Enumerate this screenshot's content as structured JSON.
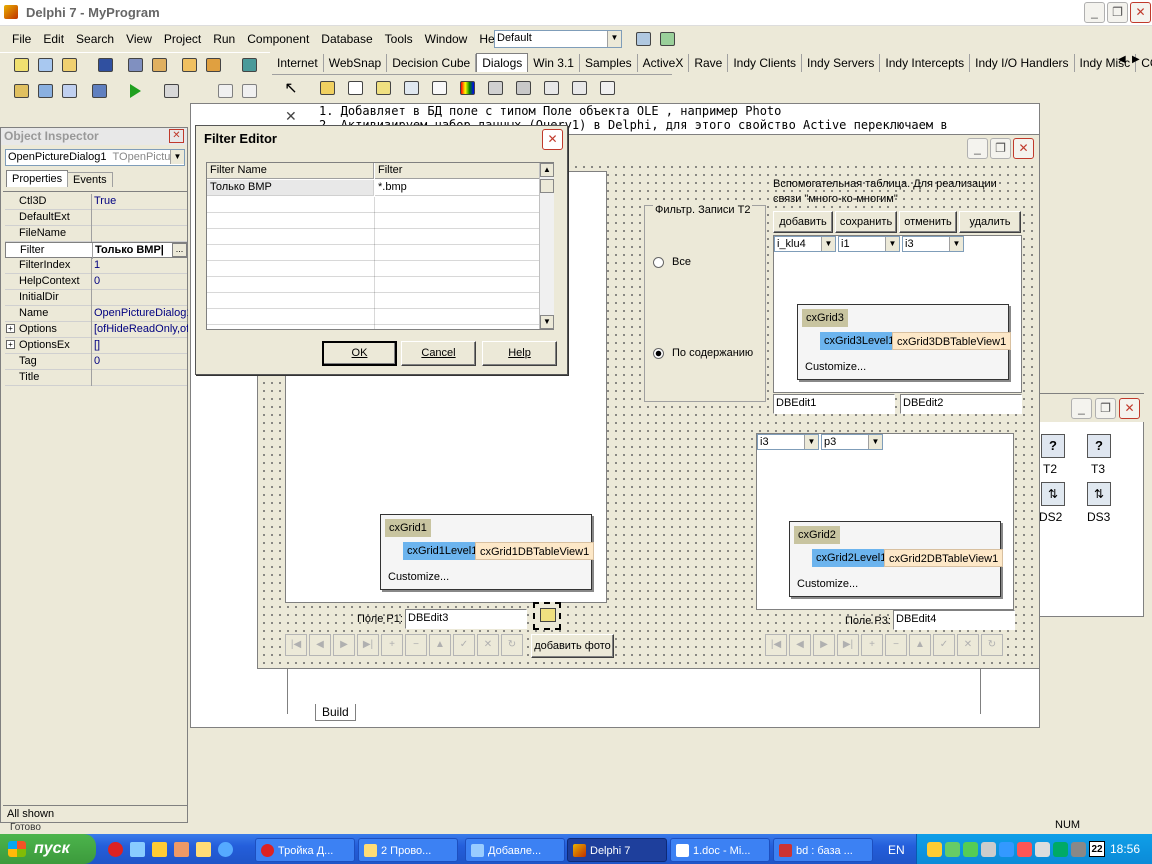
{
  "main_window": {
    "title": "Delphi 7 - MyProgram",
    "menu": [
      "File",
      "Edit",
      "Search",
      "View",
      "Project",
      "Run",
      "Component",
      "Database",
      "Tools",
      "Window",
      "Help"
    ],
    "desktop_combo": "Default",
    "palette_tabs": [
      "Internet",
      "WebSnap",
      "Decision Cube",
      "Dialogs",
      "Win 3.1",
      "Samples",
      "ActiveX",
      "Rave",
      "Indy Clients",
      "Indy Servers",
      "Indy Intercepts",
      "Indy I/O Handlers",
      "Indy Misc",
      "COM+"
    ],
    "active_palette_tab": "Dialogs"
  },
  "code_editor": {
    "line1": "1. Добавляет в БД поле с типом  Поле объекта OLE , например Photo",
    "line2": "2. Активизируем набор данных (Query1) в Delphi, для этого свойство Active переключаем в",
    "build_tab": "Build"
  },
  "object_inspector": {
    "title": "Object Inspector",
    "component_name": "OpenPictureDialog1",
    "component_type": "TOpenPictur",
    "tabs": [
      "Properties",
      "Events"
    ],
    "properties": [
      {
        "name": "Ctl3D",
        "value": "True",
        "expandable": false
      },
      {
        "name": "DefaultExt",
        "value": "",
        "expandable": false
      },
      {
        "name": "FileName",
        "value": "",
        "expandable": false
      },
      {
        "name": "Filter",
        "value": "Только BMP|",
        "expandable": false,
        "selected": true
      },
      {
        "name": "FilterIndex",
        "value": "1",
        "expandable": false
      },
      {
        "name": "HelpContext",
        "value": "0",
        "expandable": false
      },
      {
        "name": "InitialDir",
        "value": "",
        "expandable": false
      },
      {
        "name": "Name",
        "value": "OpenPictureDialog1",
        "expandable": false
      },
      {
        "name": "Options",
        "value": "[ofHideReadOnly,of",
        "expandable": true
      },
      {
        "name": "OptionsEx",
        "value": "[]",
        "expandable": true
      },
      {
        "name": "Tag",
        "value": "0",
        "expandable": false
      },
      {
        "name": "Title",
        "value": "",
        "expandable": false
      }
    ],
    "status": "All shown",
    "behind_status": "Готово"
  },
  "filter_editor": {
    "title": "Filter Editor",
    "col_name": "Filter Name",
    "col_filter": "Filter",
    "rows": [
      {
        "name": "Только BMP",
        "filter": "*.bmp"
      }
    ],
    "ok": "OK",
    "cancel": "Cancel",
    "help": "Help"
  },
  "form": {
    "filter_group_title": "Фильтр. Записи Т2",
    "radio_all": "Все",
    "radio_content": "По содержанию",
    "aux_label": "Вспомогательная таблица. Для реализации связи \"много-ко-многим\"",
    "btn_add": "добавить",
    "btn_save": "сохранить",
    "btn_cancel": "отменить",
    "btn_delete": "удалить",
    "combos_top": [
      "i_klu4",
      "i1",
      "i3"
    ],
    "combos_mid": [
      "i3",
      "p3"
    ],
    "grid1": {
      "name": "cxGrid1",
      "level": "cxGrid1Level1",
      "view": "cxGrid1DBTableView1",
      "customize": "Customize..."
    },
    "grid2": {
      "name": "cxGrid2",
      "level": "cxGrid2Level1",
      "view": "cxGrid2DBTableView1",
      "customize": "Customize..."
    },
    "grid3": {
      "name": "cxGrid3",
      "level": "cxGrid3Level1",
      "view": "cxGrid3DBTableView1",
      "customize": "Customize..."
    },
    "dbedit1": "DBEdit1",
    "dbedit2": "DBEdit2",
    "field_p1_label": "Поле Р1:",
    "dbedit3": "DBEdit3",
    "field_p3_label": "Поле Р3:",
    "dbedit4": "DBEdit4",
    "add_photo": "добавить фото"
  },
  "datamodule": {
    "items": [
      {
        "label": "T2"
      },
      {
        "label": "T3"
      },
      {
        "label": "DS2"
      },
      {
        "label": "DS3"
      }
    ]
  },
  "taskbar": {
    "start": "пуск",
    "tasks": [
      "Тройка Д...",
      "2 Прово...",
      "Добавле...",
      "Delphi 7",
      "1.doc - Mi...",
      "bd : база ..."
    ],
    "active_task": "Delphi 7",
    "lang": "EN",
    "num": "NUM",
    "clock": "18:56",
    "tray_num": "22"
  },
  "colors": {
    "taskbar": "#245edb",
    "start": "#3c9a3c",
    "grid_level": "#6cb4ee",
    "grid_view": "#fde8c8",
    "grid_header": "#c8c4a0"
  }
}
